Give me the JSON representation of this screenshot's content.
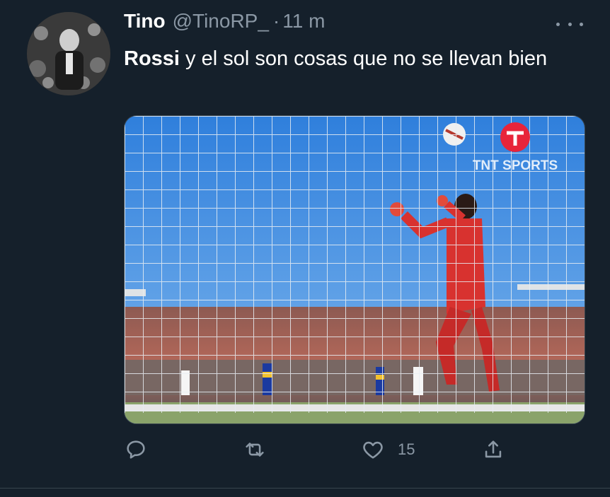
{
  "tweet": {
    "display_name": "Tino",
    "handle": "@TinoRP_",
    "separator": "·",
    "time": "11 m",
    "text_mention": "Rossi",
    "text_body": " y el sol son cosas que no se llevan bien",
    "media": {
      "broadcaster_logo_text": "TNT SPORTS"
    },
    "actions": {
      "reply_count": "",
      "retweet_count": "",
      "like_count": "15",
      "share_count": ""
    }
  },
  "colors": {
    "background": "#15202b",
    "secondary_text": "#8b98a5",
    "primary_text": "#ffffff",
    "border": "#38444d"
  },
  "icons": [
    "more-icon",
    "reply-icon",
    "retweet-icon",
    "like-icon",
    "share-icon"
  ]
}
